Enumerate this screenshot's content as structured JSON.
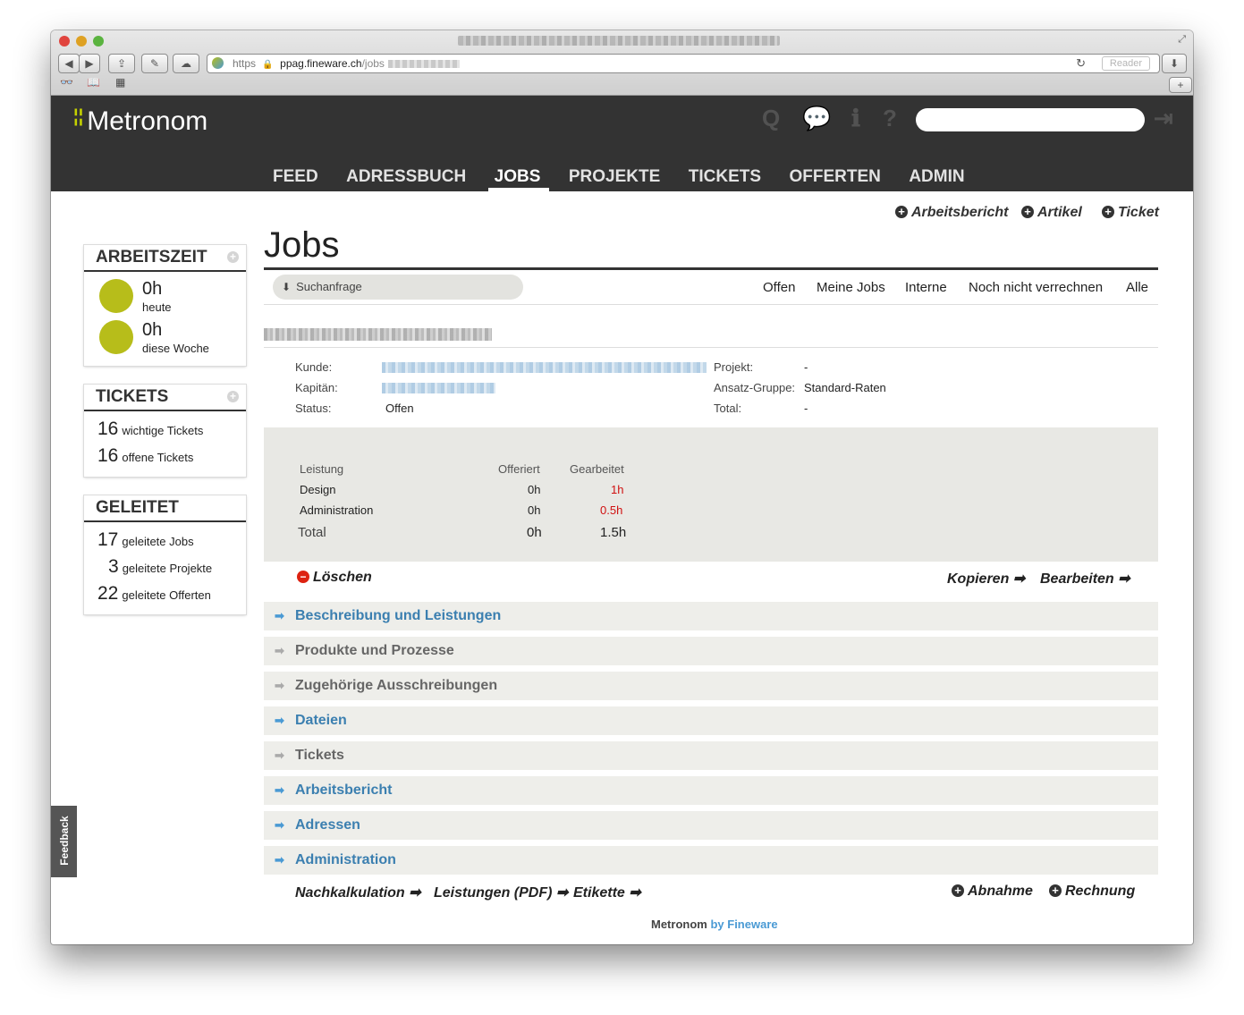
{
  "browser": {
    "url_scheme": "https",
    "url_host": "ppag.fineware.ch",
    "url_path": "/jobs",
    "reader_label": "Reader"
  },
  "app": {
    "name": "Metronom",
    "nav": [
      "FEED",
      "ADRESSBUCH",
      "JOBS",
      "PROJEKTE",
      "TICKETS",
      "OFFERTEN",
      "ADMIN"
    ],
    "active_nav": "JOBS",
    "search_placeholder": ""
  },
  "sidebar": {
    "arbeitszeit": {
      "title": "ARBEITSZEIT",
      "items": [
        {
          "value": "0h",
          "label": "heute"
        },
        {
          "value": "0h",
          "label": "diese Woche"
        }
      ]
    },
    "tickets": {
      "title": "TICKETS",
      "items": [
        {
          "count": "16",
          "label": "wichtige Tickets"
        },
        {
          "count": "16",
          "label": "offene Tickets"
        }
      ]
    },
    "geleitet": {
      "title": "GELEITET",
      "items": [
        {
          "count": "17",
          "label": "geleitete Jobs"
        },
        {
          "count": "3",
          "label": "geleitete Projekte"
        },
        {
          "count": "22",
          "label": "geleitete Offerten"
        }
      ]
    }
  },
  "main": {
    "top_actions": [
      "Arbeitsbericht",
      "Artikel",
      "Ticket"
    ],
    "title": "Jobs",
    "search_query_label": "Suchanfrage",
    "filters": [
      "Offen",
      "Meine Jobs",
      "Interne",
      "Noch nicht verrechnen",
      "Alle"
    ],
    "details": {
      "kunde_label": "Kunde:",
      "kapitaen_label": "Kapitän:",
      "status_label": "Status:",
      "status_value": "Offen",
      "projekt_label": "Projekt:",
      "projekt_value": "-",
      "ansatz_label": "Ansatz-Gruppe:",
      "ansatz_value": "Standard-Raten",
      "total_label": "Total:",
      "total_value": "-"
    },
    "table": {
      "headers": [
        "Leistung",
        "Offeriert",
        "Gearbeitet"
      ],
      "rows": [
        {
          "leistung": "Design",
          "offeriert": "0h",
          "gearbeitet": "1h"
        },
        {
          "leistung": "Administration",
          "offeriert": "0h",
          "gearbeitet": "0.5h"
        }
      ],
      "total": {
        "label": "Total",
        "offeriert": "0h",
        "gearbeitet": "1.5h"
      }
    },
    "loeschen_label": "Löschen",
    "kopieren_label": "Kopieren",
    "bearbeiten_label": "Bearbeiten",
    "sections": [
      {
        "label": "Beschreibung und Leistungen",
        "state": "link"
      },
      {
        "label": "Produkte und Prozesse",
        "state": "muted"
      },
      {
        "label": "Zugehörige Ausschreibungen",
        "state": "muted"
      },
      {
        "label": "Dateien",
        "state": "link"
      },
      {
        "label": "Tickets",
        "state": "muted"
      },
      {
        "label": "Arbeitsbericht",
        "state": "link"
      },
      {
        "label": "Adressen",
        "state": "link"
      },
      {
        "label": "Administration",
        "state": "link"
      }
    ],
    "bottom_links": [
      "Nachkalkulation",
      "Leistungen (PDF)",
      "Etikette"
    ],
    "bottom_adds": [
      "Abnahme",
      "Rechnung"
    ]
  },
  "feedback_label": "Feedback",
  "footer": {
    "brand": "Metronom",
    "by": "by Fineware"
  },
  "colors": {
    "header": "#333333",
    "accent": "#b7bd1a",
    "link": "#3b7fb0",
    "danger": "#d01010"
  }
}
